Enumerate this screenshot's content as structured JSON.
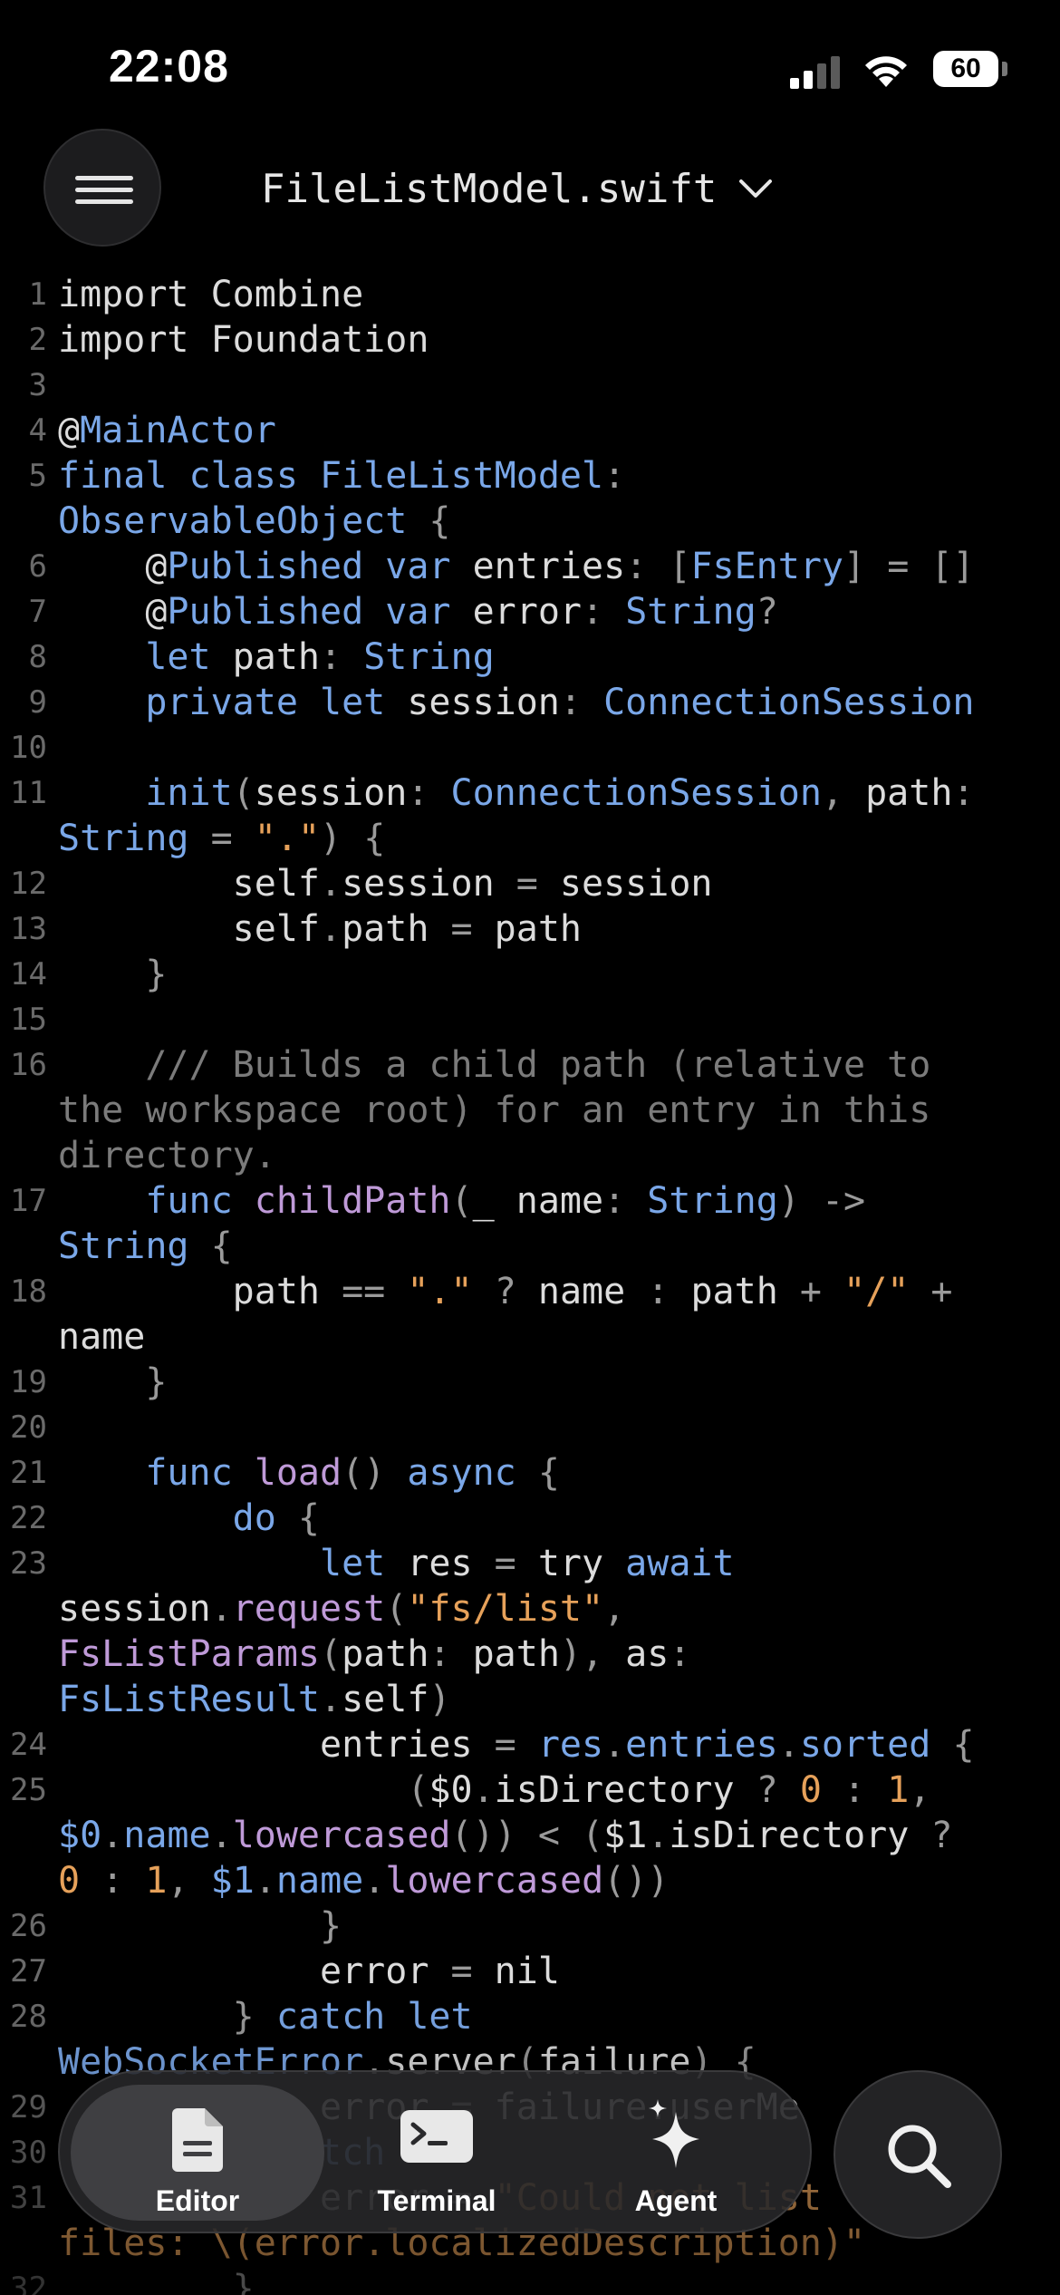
{
  "status_bar": {
    "time": "22:08",
    "battery": "60"
  },
  "header": {
    "file_name": "FileListModel.swift"
  },
  "editor": {
    "line_numbers": [
      "1",
      "2",
      "3",
      "4",
      "5",
      "6",
      "7",
      "8",
      "9",
      "10",
      "11",
      "12",
      "13",
      "14",
      "15",
      "16",
      "17",
      "18",
      "19",
      "20",
      "21",
      "22",
      "23",
      "24",
      "25",
      "26",
      "27",
      "28",
      "29",
      "30",
      "31",
      "32"
    ]
  },
  "tab_bar": {
    "tabs": [
      {
        "label": "Editor",
        "icon": "document-icon",
        "active": true
      },
      {
        "label": "Terminal",
        "icon": "terminal-icon",
        "active": false
      },
      {
        "label": "Agent",
        "icon": "sparkle-icon",
        "active": false
      }
    ],
    "search_icon": "search-icon"
  },
  "colors": {
    "keyword": "#7aa7e8",
    "function": "#bf9ad8",
    "string": "#e6a15a",
    "comment": "#7b7b7b",
    "background": "#000000"
  }
}
